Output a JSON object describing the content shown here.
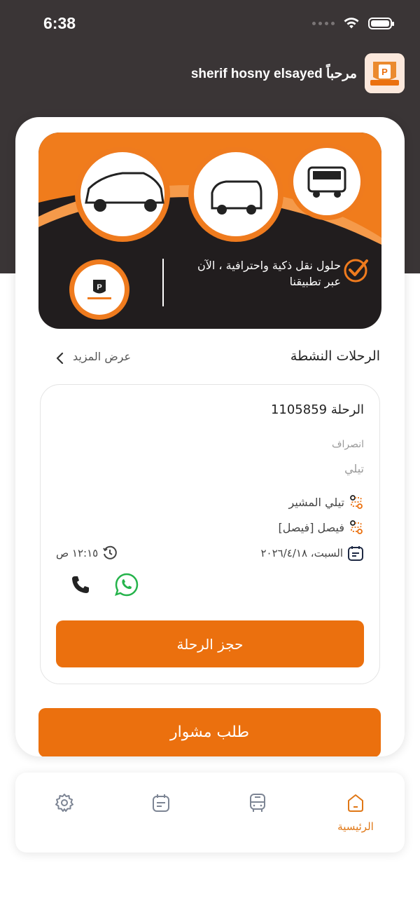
{
  "status_bar": {
    "time": "6:38"
  },
  "header": {
    "greeting": "مرحباً sherif hosny elsayed"
  },
  "banner": {
    "tagline": "حلول نقل ذكية واحترافية ، الآن عبر تطبيقنا"
  },
  "active_trips": {
    "title": "الرحلات النشطة",
    "more_label": "عرض المزيد"
  },
  "trip": {
    "title": "الرحلة 1105859",
    "type": "انصراف",
    "line": "تيلي",
    "from": "تيلي المشير",
    "to": "فيصل [فيصل]",
    "date": "السبت، ٢٠٢٦/٤/١٨",
    "time": "١٢:١٥ ص",
    "book_label": "حجز الرحلة"
  },
  "request_label": "طلب مشوار",
  "tabbar": {
    "home_label": "الرئيسية"
  },
  "colors": {
    "accent": "#eb700e",
    "dark": "#3a3536"
  }
}
